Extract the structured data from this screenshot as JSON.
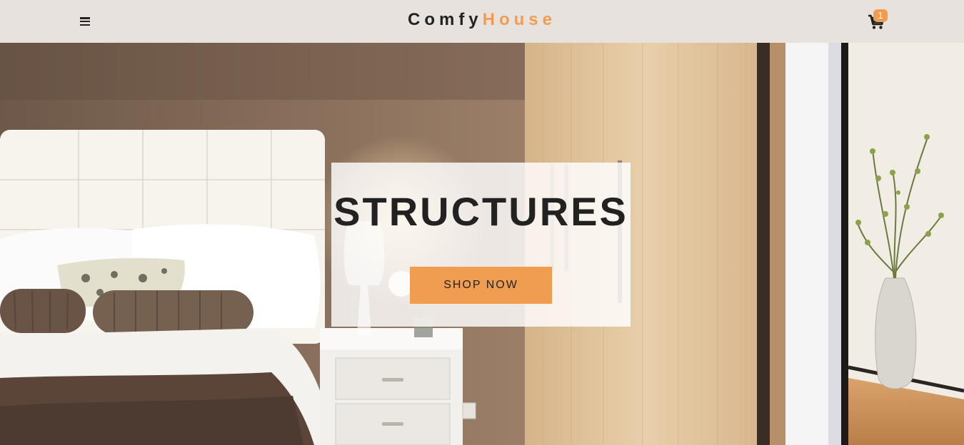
{
  "navbar": {
    "brand_part1": "Comfy",
    "brand_part2": "House",
    "cart_count": "1",
    "menu_icon": "hamburger-menu-icon",
    "cart_icon": "shopping-cart-icon"
  },
  "hero": {
    "title": "STRUCTURES",
    "button_label": "SHOP NOW"
  },
  "colors": {
    "accent": "#f09d51",
    "navbar_bg": "#e7e2dd",
    "text_dark": "#222222"
  }
}
